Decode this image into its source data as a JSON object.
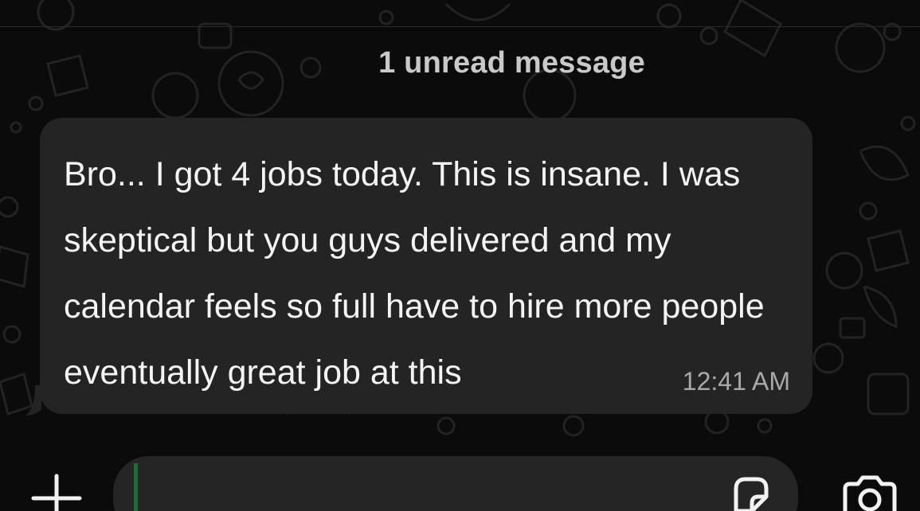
{
  "chat": {
    "unread_banner": "1 unread message",
    "message": {
      "text": "Bro... I got 4 jobs today. This is insane. I was skeptical but you guys delivered and my calendar feels so full have to hire more people eventually great job at this",
      "time": "12:41 AM"
    }
  },
  "composer": {
    "placeholder": "",
    "icons": {
      "left": "plus-icon",
      "sticker": "sticker-icon",
      "camera": "camera-icon"
    }
  },
  "colors": {
    "background": "#0b0b0b",
    "bubble": "#242424",
    "text": "#f4f4f4",
    "muted": "#a9a9a9",
    "caret": "#1f6b3a"
  }
}
